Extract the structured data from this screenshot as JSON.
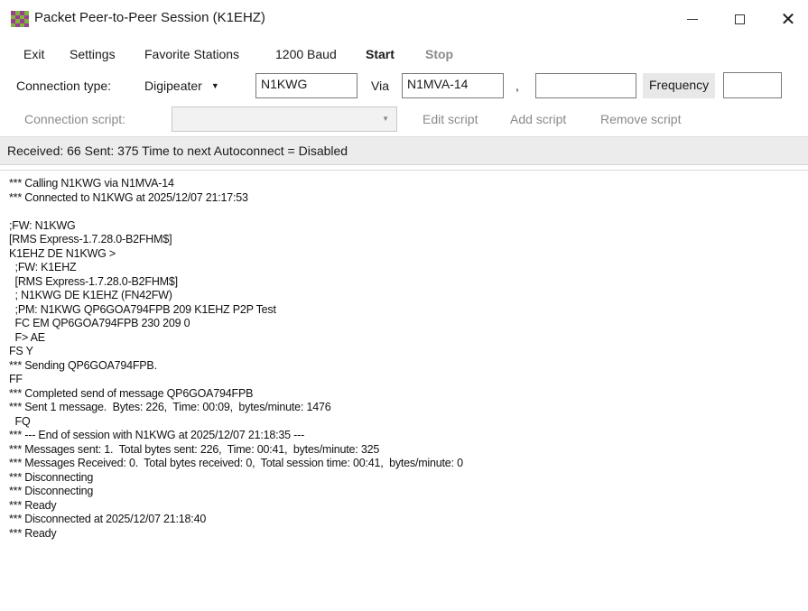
{
  "window": {
    "title": "Packet Peer-to-Peer Session  (K1EHZ)"
  },
  "menu": {
    "exit": "Exit",
    "settings": "Settings",
    "favorite_stations": "Favorite Stations",
    "baud": "1200 Baud",
    "start": "Start",
    "stop": "Stop"
  },
  "connection": {
    "type_label": "Connection type:",
    "type_value": "Digipeater",
    "station_value": "N1KWG",
    "via_label": "Via",
    "via_value": "N1MVA-14",
    "comma": ",",
    "via2_value": "",
    "frequency_label": "Frequency",
    "frequency_value": ""
  },
  "script": {
    "label": "Connection script:",
    "value": "",
    "edit": "Edit script",
    "add": "Add script",
    "remove": "Remove script"
  },
  "status": {
    "text": "Received: 66  Sent: 375  Time to next Autoconnect = Disabled"
  },
  "log_lines": [
    "*** Calling N1KWG via N1MVA-14",
    "*** Connected to N1KWG at 2025/12/07 21:17:53",
    "",
    ";FW: N1KWG",
    "[RMS Express-1.7.28.0-B2FHM$]",
    "K1EHZ DE N1KWG >",
    "  ;FW: K1EHZ",
    "  [RMS Express-1.7.28.0-B2FHM$]",
    "  ; N1KWG DE K1EHZ (FN42FW)",
    "  ;PM: N1KWG QP6GOA794FPB 209 K1EHZ P2P Test",
    "  FC EM QP6GOA794FPB 230 209 0",
    "  F> AE",
    "FS Y",
    "*** Sending QP6GOA794FPB.",
    "FF",
    "*** Completed send of message QP6GOA794FPB",
    "*** Sent 1 message.  Bytes: 226,  Time: 00:09,  bytes/minute: 1476",
    "  FQ",
    "*** --- End of session with N1KWG at 2025/12/07 21:18:35 ---",
    "*** Messages sent: 1.  Total bytes sent: 226,  Time: 00:41,  bytes/minute: 325",
    "*** Messages Received: 0.  Total bytes received: 0,  Total session time: 00:41,  bytes/minute: 0",
    "*** Disconnecting",
    "*** Disconnecting",
    "*** Ready",
    "*** Disconnected at 2025/12/07 21:18:40",
    "*** Ready"
  ],
  "icons": {
    "app": "checkered-app-icon",
    "dropdown": "chevron-down-icon"
  },
  "colors": {
    "app_icon_a": "#9b3f8f",
    "app_icon_b": "#7fb241",
    "status_bg": "#ececec",
    "disabled_text": "#8a8a8a"
  }
}
